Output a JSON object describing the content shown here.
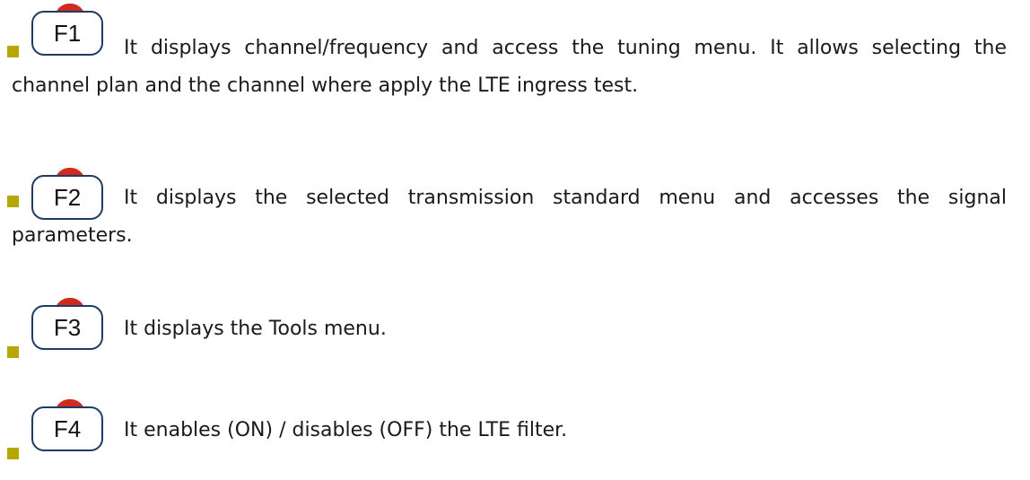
{
  "items": [
    {
      "key_label": "F1",
      "description": "It displays channel/frequency and access the tuning menu. It allows selecting the channel plan and the channel where apply the LTE ingress test."
    },
    {
      "key_label": "F2",
      "description": "It displays the selected transmission standard menu and accesses the signal parameters."
    },
    {
      "key_label": "F3",
      "description": "It displays the Tools menu."
    },
    {
      "key_label": "F4",
      "description": "It enables (ON) / disables (OFF) the LTE filter."
    }
  ],
  "colors": {
    "bullet": "#b6a800",
    "key_border": "#1f3b62",
    "key_led": "#d32a1e"
  },
  "icons": {
    "bullet": "square-bullet-icon",
    "key_led": "red-led-icon"
  }
}
